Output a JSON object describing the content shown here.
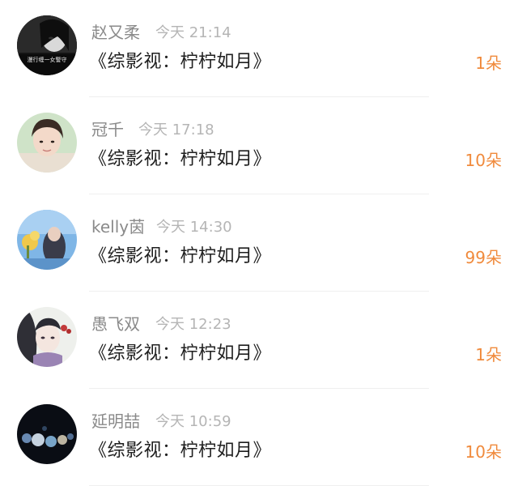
{
  "messages": [
    {
      "name": "赵又柔",
      "time": "今天 21:14",
      "content": "《综影视：柠柠如月》",
      "count": "1朵",
      "avatar_caption": "漫行缠一女警守"
    },
    {
      "name": "冠千",
      "time": "今天 17:18",
      "content": "《综影视：柠柠如月》",
      "count": "10朵"
    },
    {
      "name": "kelly茵",
      "time": "今天 14:30",
      "content": "《综影视：柠柠如月》",
      "count": "99朵"
    },
    {
      "name": "愚飞双",
      "time": "今天 12:23",
      "content": "《综影视：柠柠如月》",
      "count": "1朵"
    },
    {
      "name": "延明喆",
      "time": "今天 10:59",
      "content": "《综影视：柠柠如月》",
      "count": "10朵"
    }
  ],
  "colors": {
    "name": "#8a8a8a",
    "time": "#b5b5b5",
    "content": "#1f1f1f",
    "count": "#f08a3c",
    "divider": "#efefef"
  }
}
